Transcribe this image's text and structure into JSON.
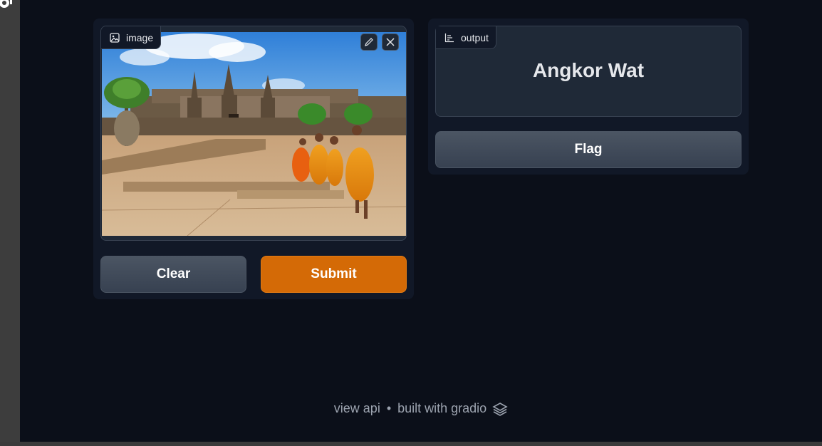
{
  "input": {
    "label": "image",
    "icons": {
      "label": "image-icon",
      "edit": "pencil-icon",
      "clear": "close-icon"
    }
  },
  "buttons": {
    "clear": "Clear",
    "submit": "Submit",
    "flag": "Flag"
  },
  "output": {
    "label": "output",
    "icon": "bar-chart-icon",
    "value": "Angkor Wat"
  },
  "footer": {
    "view_api": "view api",
    "separator": "•",
    "built_with": "built with gradio",
    "logo_icon": "gradio-logo-icon"
  },
  "colors": {
    "background": "#0b0f19",
    "panel": "#111827",
    "block": "#1f2937",
    "accent": "#d46a06",
    "text": "#e5e7eb",
    "muted": "#9ca3af"
  }
}
